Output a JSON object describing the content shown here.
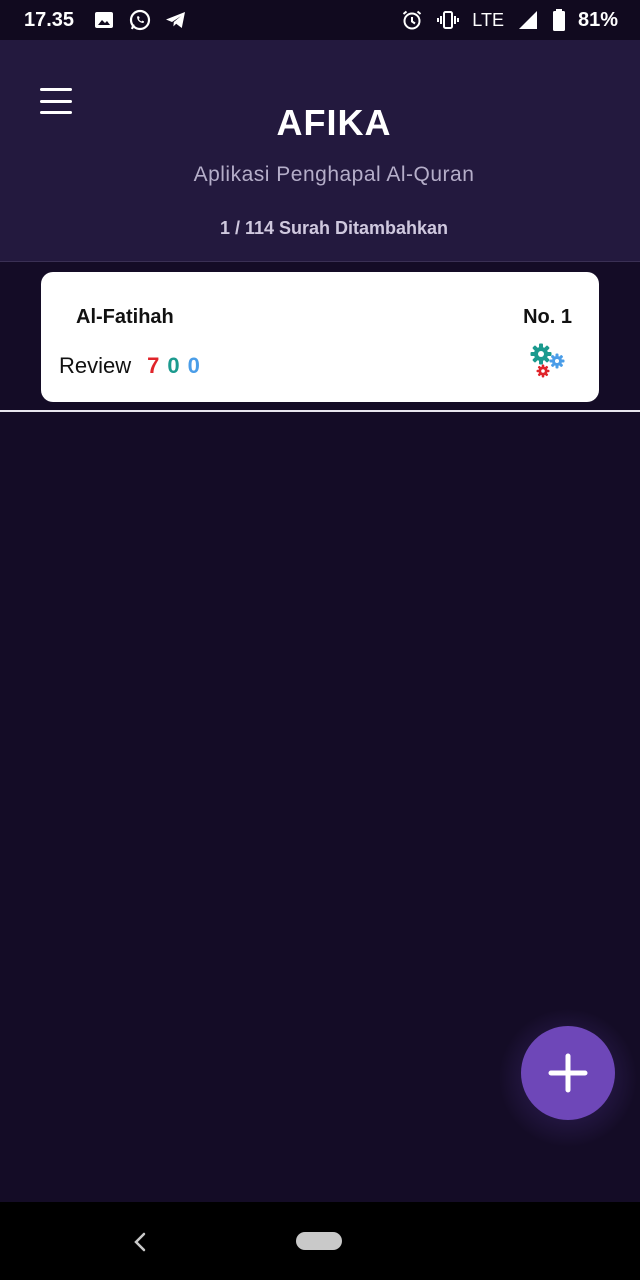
{
  "status_bar": {
    "time": "17.35",
    "network": "LTE",
    "battery": "81%",
    "icons": [
      "image-icon",
      "whatsapp-icon",
      "telegram-icon",
      "alarm-icon",
      "vibrate-icon",
      "signal-icon",
      "battery-icon"
    ]
  },
  "header": {
    "title": "AFIKA",
    "subtitle": "Aplikasi Penghapal Al-Quran",
    "count": "1 / 114 Surah Ditambahkan"
  },
  "surahs": [
    {
      "name": "Al-Fatihah",
      "number": "No. 1",
      "review_label": "Review",
      "counts": {
        "red": "7",
        "teal": "0",
        "blue": "0"
      }
    }
  ],
  "colors": {
    "background": "#140c26",
    "header": "#23193e",
    "fab": "#6e47b8",
    "count_red": "#e0242a",
    "count_teal": "#1b9a8e",
    "count_blue": "#4a9de8"
  },
  "fab": {
    "icon": "plus-icon"
  }
}
